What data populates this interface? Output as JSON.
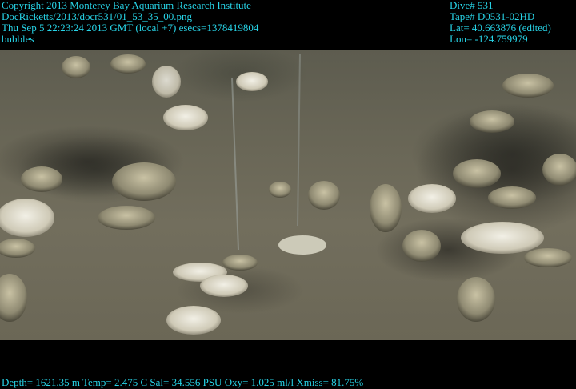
{
  "overlay": {
    "copyright": "Copyright 2013 Monterey Bay Aquarium Research Institute",
    "file_path": "DocRicketts/2013/docr531/01_53_35_00.png",
    "timestamp": "Thu Sep  5 22:23:24 2013 GMT (local +7)  esecs=1378419804",
    "annotation": "bubbles",
    "dive": "Dive# 531",
    "tape": "Tape# D0531-02HD",
    "lat": "Lat= 40.663876 (edited)",
    "lon": "Lon= -124.759979",
    "sensors": "Depth= 1621.35 m  Temp= 2.475 C  Sal= 34.556 PSU  Oxy= 1.025 ml/l  Xmiss= 81.75%"
  },
  "colors": {
    "overlay_text": "#27d3e6",
    "letterbox": "#000000",
    "seafloor": "#6a6757"
  }
}
